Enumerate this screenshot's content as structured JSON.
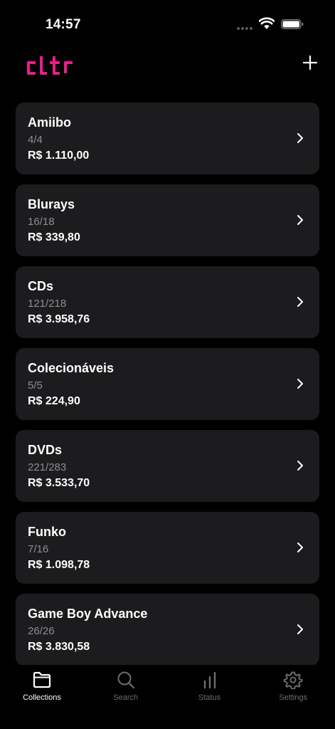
{
  "status": {
    "time": "14:57"
  },
  "header": {
    "logo_text": "cltr",
    "add_icon": "plus-icon"
  },
  "collections": [
    {
      "name": "Amiibo",
      "count": "4/4",
      "value": "R$ 1.110,00"
    },
    {
      "name": "Blurays",
      "count": "16/18",
      "value": "R$ 339,80"
    },
    {
      "name": "CDs",
      "count": "121/218",
      "value": "R$ 3.958,76"
    },
    {
      "name": "Colecionáveis",
      "count": "5/5",
      "value": "R$ 224,90"
    },
    {
      "name": "DVDs",
      "count": "221/283",
      "value": "R$ 3.533,70"
    },
    {
      "name": "Funko",
      "count": "7/16",
      "value": "R$ 1.098,78"
    },
    {
      "name": "Game Boy Advance",
      "count": "26/26",
      "value": "R$ 3.830,58"
    }
  ],
  "tabs": [
    {
      "label": "Collections",
      "icon": "folder-icon",
      "active": true
    },
    {
      "label": "Search",
      "icon": "search-icon",
      "active": false
    },
    {
      "label": "Status",
      "icon": "bar-chart-icon",
      "active": false
    },
    {
      "label": "Settings",
      "icon": "gear-icon",
      "active": false
    }
  ],
  "colors": {
    "accent": "#e91e8c",
    "card_bg": "#1c1c1e",
    "muted": "#8e8e93",
    "background": "#000000"
  }
}
